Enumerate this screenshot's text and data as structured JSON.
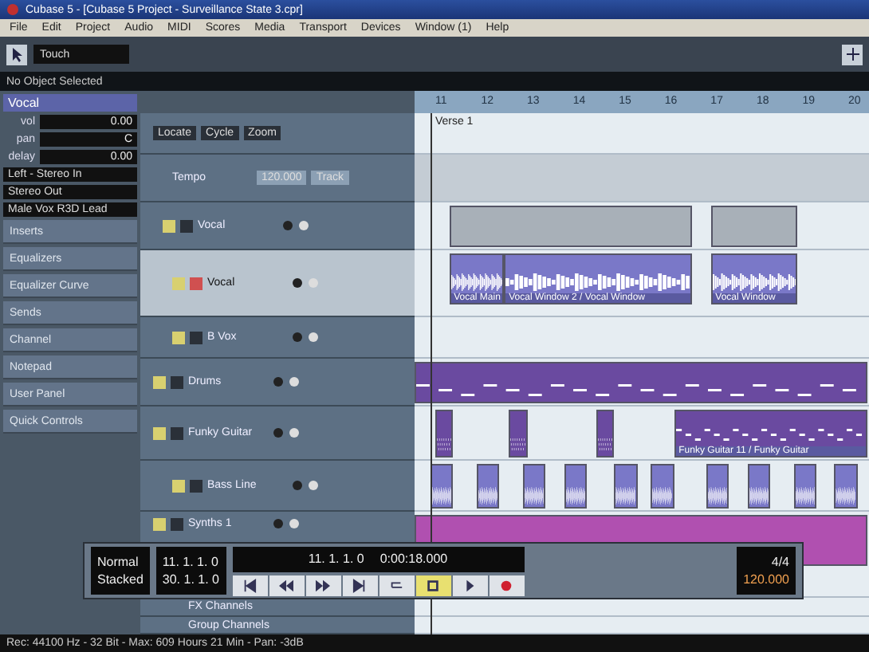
{
  "window": {
    "title": "Cubase 5 - [Cubase 5 Project - Surveillance State 3.cpr]"
  },
  "menu": [
    "File",
    "Edit",
    "Project",
    "Audio",
    "MIDI",
    "Scores",
    "Media",
    "Transport",
    "Devices",
    "Window (1)",
    "Help"
  ],
  "toolbar": {
    "automation_mode": "Touch"
  },
  "info_line": "No Object Selected",
  "inspector": {
    "track_name": "Vocal",
    "params": [
      {
        "label": "vol",
        "value": "0.00"
      },
      {
        "label": "pan",
        "value": "C"
      },
      {
        "label": "delay",
        "value": "0.00"
      }
    ],
    "routing": [
      "Left - Stereo In",
      "Stereo Out"
    ],
    "preset": "Male Vox R3D Lead",
    "sections": [
      "Inserts",
      "Equalizers",
      "Equalizer Curve",
      "Sends",
      "Channel",
      "Notepad",
      "User Panel",
      "Quick Controls"
    ]
  },
  "ruler": [
    "11",
    "12",
    "13",
    "14",
    "15",
    "16",
    "17",
    "18",
    "19",
    "20"
  ],
  "tracks": [
    {
      "kind": "marker",
      "buttons": [
        "Locate",
        "Cycle",
        "Zoom"
      ],
      "markers": [
        "Verse 1"
      ]
    },
    {
      "kind": "tempo",
      "name": "Tempo",
      "value": "120.000",
      "mode": "Track"
    },
    {
      "kind": "folder",
      "name": "Vocal",
      "selected": false
    },
    {
      "kind": "audio",
      "name": "Vocal",
      "selected": true,
      "events": [
        "Vocal Main",
        "Vocal Window 2 / Vocal Window",
        "Vocal Window"
      ]
    },
    {
      "kind": "audio",
      "name": "B Vox",
      "selected": false
    },
    {
      "kind": "midi",
      "name": "Drums",
      "selected": false
    },
    {
      "kind": "midi",
      "name": "Funky Guitar",
      "selected": false,
      "events": [
        "Funky Guitar 11 / Funky Guitar"
      ]
    },
    {
      "kind": "audio",
      "name": "Bass Line",
      "selected": false
    },
    {
      "kind": "synth",
      "name": "Synths 1",
      "selected": false
    },
    {
      "kind": "channel_folder",
      "name": "FX Channels"
    },
    {
      "kind": "channel_folder",
      "name": "Group Channels"
    }
  ],
  "transport": {
    "record_mode": "Normal",
    "cycle_mode": "Stacked",
    "left_locator": "11. 1. 1. 0",
    "right_locator": "30. 1. 1. 0",
    "position": "11. 1. 1. 0",
    "time": "0:00:18.000",
    "signature": "4/4",
    "tempo": "120.000",
    "buttons": [
      {
        "kind": "start",
        "on": false
      },
      {
        "kind": "rewind",
        "on": false
      },
      {
        "kind": "forward",
        "on": false
      },
      {
        "kind": "end",
        "on": false
      },
      {
        "kind": "cycle",
        "on": false
      },
      {
        "kind": "stop",
        "on": true
      },
      {
        "kind": "play",
        "on": false
      },
      {
        "kind": "record",
        "on": false
      }
    ]
  },
  "status_bar": "Rec: 44100 Hz - 32 Bit - Max: 609 Hours 21 Min - Pan: -3dB"
}
